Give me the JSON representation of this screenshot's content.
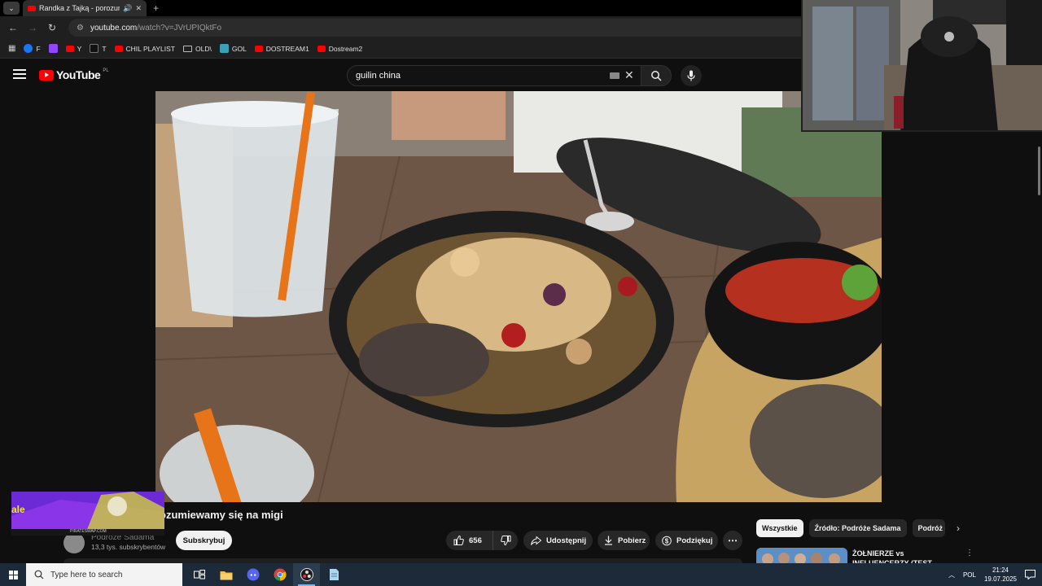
{
  "browser": {
    "tab_title": "Randka z Tajką - porozumie",
    "url_host": "youtube.com",
    "url_path": "/watch?v=JVrUPIQktFo",
    "bookmarks": [
      {
        "label": "F",
        "icon": "facebook-icon"
      },
      {
        "label": "",
        "icon": "twitch-icon"
      },
      {
        "label": "Y",
        "icon": "youtube-icon"
      },
      {
        "label": "T",
        "icon": "x-icon"
      },
      {
        "label": "CHIL PLAYLIST",
        "icon": "youtube-icon"
      },
      {
        "label": "OLD\\",
        "icon": "folder-icon"
      },
      {
        "label": "GOL",
        "icon": "gol-icon"
      },
      {
        "label": "DOSTREAM1",
        "icon": "youtube-icon"
      },
      {
        "label": "Dostream2",
        "icon": "youtube-icon"
      }
    ]
  },
  "youtube": {
    "logo_text": "YouTube",
    "region": "PL",
    "search_query": "guilin china",
    "video_title": "ozumiewamy się na migi",
    "channel_name": "Podróże Sadama",
    "subscribers": "13,3 tys. subskrybentów",
    "subscribe_label": "Subskrybuj",
    "likes": "656",
    "share_label": "Udostępnij",
    "download_label": "Pobierz",
    "thanks_label": "Podziękuj",
    "chips": [
      "Wszystkie",
      "Źródło: Podróże Sadama",
      "Podróż d"
    ],
    "rec_title": "ŻOŁNIERZE vs INFLUENCERZY (TEST LIDERA)",
    "ad_text": "PIRATESWAP.COM"
  },
  "taskbar": {
    "search_placeholder": "Type here to search",
    "language": "POL",
    "time": "21:24",
    "date": "19.07.2025"
  }
}
